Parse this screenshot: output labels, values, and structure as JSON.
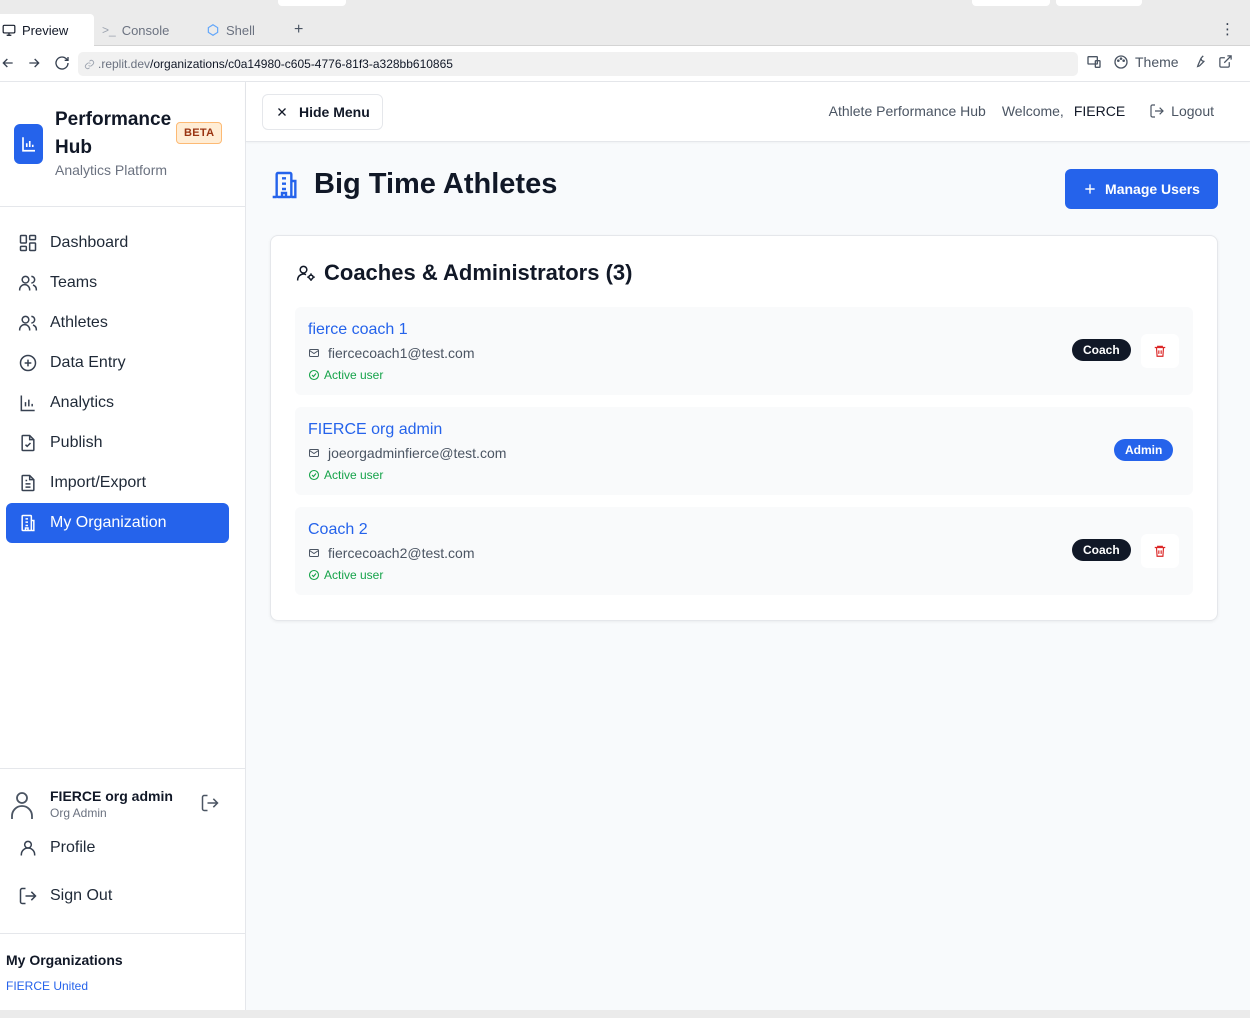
{
  "browser": {
    "tabs": [
      {
        "label": "Preview",
        "icon": "monitor-icon",
        "active": true
      },
      {
        "label": "Console",
        "icon": "terminal-icon",
        "active": false
      },
      {
        "label": "Shell",
        "icon": "shell-icon",
        "active": false
      }
    ],
    "url_host": ".replit.dev",
    "url_path": "/organizations/c0a14980-c605-4776-81f3-a328bb610865",
    "theme_label": "Theme"
  },
  "sidebar": {
    "brand": {
      "title": "Performance Hub",
      "subtitle": "Analytics Platform",
      "badge": "BETA"
    },
    "nav": [
      {
        "label": "Dashboard",
        "icon": "dashboard-icon",
        "active": false
      },
      {
        "label": "Teams",
        "icon": "users-icon",
        "active": false
      },
      {
        "label": "Athletes",
        "icon": "users-icon",
        "active": false
      },
      {
        "label": "Data Entry",
        "icon": "plus-circle-icon",
        "active": false
      },
      {
        "label": "Analytics",
        "icon": "bar-chart-icon",
        "active": false
      },
      {
        "label": "Publish",
        "icon": "file-check-icon",
        "active": false
      },
      {
        "label": "Import/Export",
        "icon": "file-text-icon",
        "active": false
      },
      {
        "label": "My Organization",
        "icon": "building-icon",
        "active": true
      }
    ],
    "user": {
      "name": "FIERCE org admin",
      "role": "Org Admin"
    },
    "profile_label": "Profile",
    "signout_label": "Sign Out",
    "orgs": {
      "title": "My Organizations",
      "items": [
        "FIERCE United"
      ]
    }
  },
  "header": {
    "hide_menu": "Hide Menu",
    "app_name": "Athlete Performance Hub",
    "welcome": "Welcome,",
    "username": "FIERCE",
    "logout": "Logout"
  },
  "page": {
    "title": "Big Time Athletes",
    "manage_users": "Manage Users",
    "card_title": "Coaches & Administrators (3)",
    "members": [
      {
        "name": "fierce coach 1",
        "email": "fiercecoach1@test.com",
        "status": "Active user",
        "role": "Coach",
        "deletable": true
      },
      {
        "name": "FIERCE org admin",
        "email": "joeorgadminfierce@test.com",
        "status": "Active user",
        "role": "Admin",
        "deletable": false
      },
      {
        "name": "Coach 2",
        "email": "fiercecoach2@test.com",
        "status": "Active user",
        "role": "Coach",
        "deletable": true
      }
    ]
  },
  "colors": {
    "accent": "#2563eb",
    "danger": "#dc2626",
    "success": "#16a34a",
    "dark_badge": "#111827"
  }
}
